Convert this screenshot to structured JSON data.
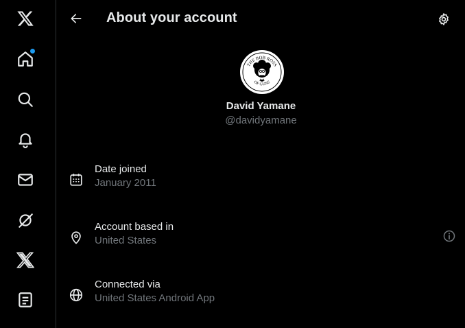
{
  "sidebar": {
    "items": [
      {
        "name": "x-logo",
        "icon": "x-logo-icon"
      },
      {
        "name": "home",
        "icon": "home-icon",
        "has_notification": true
      },
      {
        "name": "explore",
        "icon": "search-icon"
      },
      {
        "name": "notifications",
        "icon": "bell-icon"
      },
      {
        "name": "messages",
        "icon": "envelope-icon"
      },
      {
        "name": "grok",
        "icon": "grok-icon"
      },
      {
        "name": "premium",
        "icon": "x-logo-icon"
      },
      {
        "name": "lists",
        "icon": "list-icon"
      }
    ],
    "notification_dot_color": "#1d9bf0"
  },
  "header": {
    "title": "About your account",
    "back_icon": "arrow-left-icon",
    "settings_icon": "gear-icon"
  },
  "profile": {
    "avatar_text_top": "THE BOB ROSS",
    "avatar_text_bottom": "OF GUNS",
    "name": "David Yamane",
    "handle": "@davidyamane"
  },
  "details": [
    {
      "icon": "calendar-icon",
      "label": "Date joined",
      "value": "January 2011"
    },
    {
      "icon": "location-pin-icon",
      "label": "Account based in",
      "value": "United States",
      "has_info": true
    },
    {
      "icon": "globe-icon",
      "label": "Connected via",
      "value": "United States Android App"
    }
  ],
  "colors": {
    "background": "#000000",
    "text_primary": "#e7e9ea",
    "text_secondary": "#71767b",
    "border": "#2f3336",
    "accent": "#1d9bf0"
  }
}
